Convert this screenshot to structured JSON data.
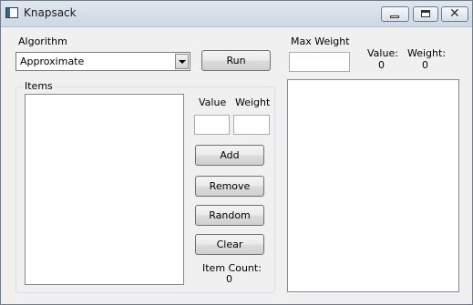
{
  "window": {
    "title": "Knapsack",
    "minimize_icon": "minimize-icon",
    "maximize_icon": "maximize-icon",
    "close_icon": "close-icon"
  },
  "algorithm": {
    "label": "Algorithm",
    "selected": "Approximate"
  },
  "run_button": "Run",
  "max_weight": {
    "label": "Max Weight",
    "value": ""
  },
  "result": {
    "value_label": "Value:",
    "value": "0",
    "weight_label": "Weight:",
    "weight": "0"
  },
  "items": {
    "legend": "Items",
    "value_label": "Value",
    "weight_label": "Weight",
    "value_input": "",
    "weight_input": "",
    "add_button": "Add",
    "remove_button": "Remove",
    "random_button": "Random",
    "clear_button": "Clear",
    "count_label": "Item Count:",
    "count": "0",
    "list": []
  },
  "results_list": []
}
